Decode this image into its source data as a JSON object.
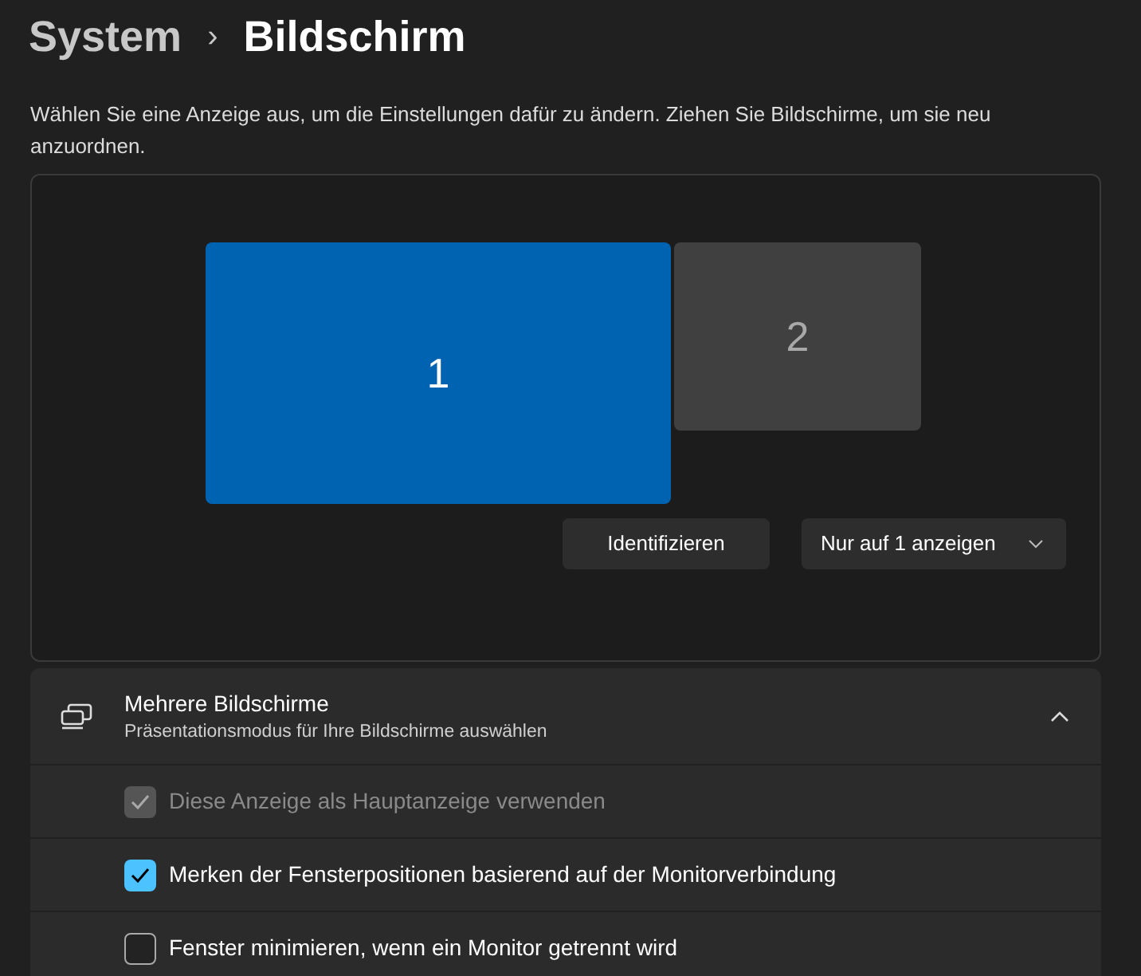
{
  "breadcrumb": {
    "parent": "System",
    "separator": "›",
    "current": "Bildschirm"
  },
  "description": "Wählen Sie eine Anzeige aus, um die Einstellungen dafür zu ändern. Ziehen Sie Bildschirme, um sie neu anzuordnen.",
  "monitors": [
    {
      "label": "1",
      "selected": true
    },
    {
      "label": "2",
      "selected": false
    }
  ],
  "identify_button": "Identifizieren",
  "display_mode": {
    "value": "Nur auf 1 anzeigen"
  },
  "multiple_displays": {
    "title": "Mehrere Bildschirme",
    "subtitle": "Präsentationsmodus für Ihre Bildschirme auswählen",
    "expanded": true,
    "options": [
      {
        "label": "Diese Anzeige als Hauptanzeige verwenden",
        "checked": true,
        "disabled": true
      },
      {
        "label": "Merken der Fensterpositionen basierend auf der Monitorverbindung",
        "checked": true,
        "disabled": false
      },
      {
        "label": "Fenster minimieren, wenn ein Monitor getrennt wird",
        "checked": false,
        "disabled": false
      }
    ]
  }
}
